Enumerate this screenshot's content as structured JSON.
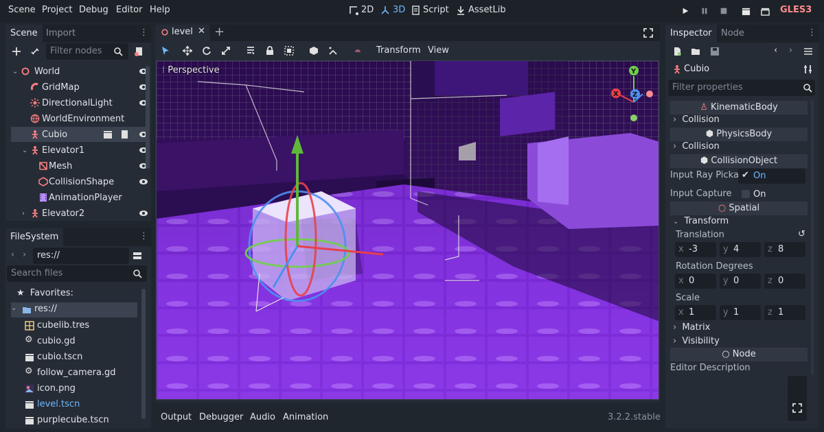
{
  "menu": [
    "Scene",
    "Project",
    "Debug",
    "Editor",
    "Help"
  ],
  "modes": [
    {
      "label": "2D",
      "icon": "2d-icon"
    },
    {
      "label": "3D",
      "icon": "3d-icon"
    },
    {
      "label": "Script",
      "icon": "script-icon"
    },
    {
      "label": "AssetLib",
      "icon": "assetlib-icon"
    }
  ],
  "renderer": "GLES3",
  "scene_panel": {
    "tabs": [
      "Scene",
      "Import"
    ],
    "filter_placeholder": "Filter nodes",
    "tree": [
      {
        "label": "World",
        "icon": "spatial-icon"
      },
      {
        "label": "GridMap",
        "icon": "gridmap-icon"
      },
      {
        "label": "DirectionalLight",
        "icon": "light-icon"
      },
      {
        "label": "WorldEnvironment",
        "icon": "environment-icon"
      },
      {
        "label": "Cubio",
        "icon": "kinematic-body-icon"
      },
      {
        "label": "Elevator1",
        "icon": "kinematic-body-icon"
      },
      {
        "label": "Mesh",
        "icon": "mesh-icon"
      },
      {
        "label": "CollisionShape",
        "icon": "collision-shape-icon"
      },
      {
        "label": "AnimationPlayer",
        "icon": "animation-player-icon"
      },
      {
        "label": "Elevator2",
        "icon": "kinematic-body-icon"
      }
    ]
  },
  "filesystem": {
    "title": "FileSystem",
    "path": "res://",
    "search_placeholder": "Search files",
    "items": [
      {
        "label": "Favorites:",
        "icon": "star-icon"
      },
      {
        "label": "res://",
        "icon": "folder-icon"
      },
      {
        "label": "cubelib.tres",
        "icon": "meshlib-icon"
      },
      {
        "label": "cubio.gd",
        "icon": "gear-icon"
      },
      {
        "label": "cubio.tscn",
        "icon": "scene-icon"
      },
      {
        "label": "follow_camera.gd",
        "icon": "gear-icon"
      },
      {
        "label": "icon.png",
        "icon": "image-icon"
      },
      {
        "label": "level.tscn",
        "icon": "scene-icon"
      },
      {
        "label": "purplecube.tscn",
        "icon": "scene-icon"
      }
    ]
  },
  "editor": {
    "tab": "level",
    "toolbar_menus": [
      "Transform",
      "View"
    ],
    "viewport_label": "Perspective",
    "gizmo_axes": [
      "X",
      "Y",
      "Z"
    ]
  },
  "bottom_tabs": [
    "Output",
    "Debugger",
    "Audio",
    "Animation"
  ],
  "version": "3.2.2.stable",
  "inspector": {
    "tabs": [
      "Inspector",
      "Node"
    ],
    "node_name": "Cubio",
    "filter_placeholder": "Filter properties",
    "sections": {
      "kinematic_body": "KinematicBody",
      "collision1": "Collision",
      "physics_body": "PhysicsBody",
      "collision2": "Collision",
      "collision_object": "CollisionObject",
      "input_ray_label": "Input Ray Picka",
      "input_ray_value": "On",
      "input_capture_label": "Input Capture",
      "input_capture_value": "On",
      "spatial": "Spatial",
      "transform": "Transform",
      "translation_label": "Translation",
      "rotation_label": "Rotation Degrees",
      "scale_label": "Scale",
      "matrix": "Matrix",
      "visibility": "Visibility",
      "node": "Node",
      "editor_description": "Editor Description"
    },
    "translation": {
      "x": "-3",
      "y": "4",
      "z": "8"
    },
    "rotation": {
      "x": "0",
      "y": "0",
      "z": "0"
    },
    "scale": {
      "x": "1",
      "y": "1",
      "z": "1"
    }
  },
  "colors": {
    "accent": "#70b8ff",
    "node_red": "#fc7f7f",
    "bg": "#20262e"
  }
}
